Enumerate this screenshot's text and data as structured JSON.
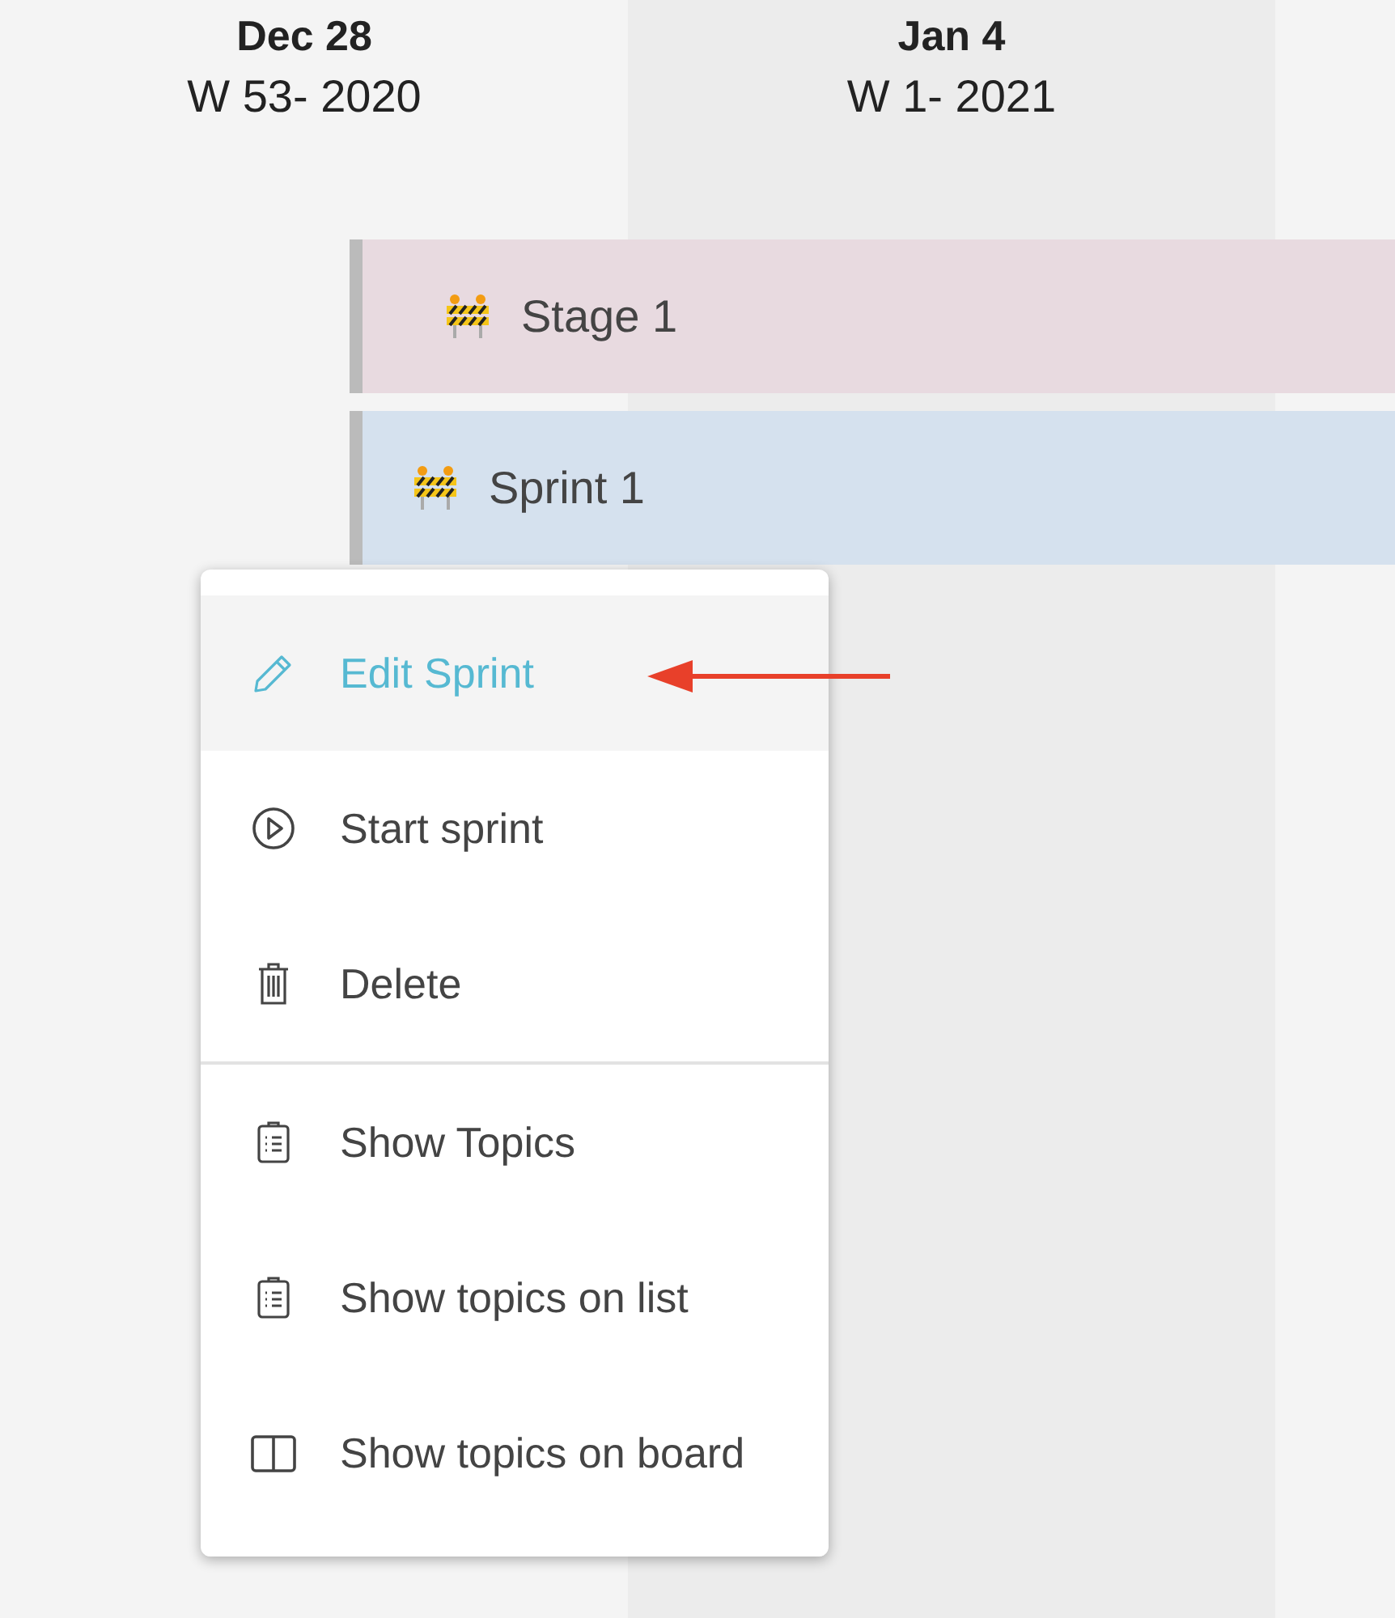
{
  "weeks": [
    {
      "date": "Dec 28",
      "week": "W 53- 2020"
    },
    {
      "date": "Jan 4",
      "week": "W 1- 2021"
    }
  ],
  "bars": [
    {
      "kind": "stage",
      "label": "Stage 1",
      "color": "#e8dae0"
    },
    {
      "kind": "sprint",
      "label": "Sprint 1",
      "color": "#d5e1ee"
    }
  ],
  "menu": {
    "groups": [
      [
        {
          "kind": "edit",
          "label": "Edit Sprint",
          "selected": true
        },
        {
          "kind": "play",
          "label": "Start sprint",
          "selected": false
        },
        {
          "kind": "delete",
          "label": "Delete",
          "selected": false
        }
      ],
      [
        {
          "kind": "clipboard",
          "label": "Show Topics",
          "selected": false
        },
        {
          "kind": "clipboard",
          "label": "Show topics on list",
          "selected": false
        },
        {
          "kind": "board",
          "label": "Show topics on board",
          "selected": false
        }
      ]
    ]
  }
}
